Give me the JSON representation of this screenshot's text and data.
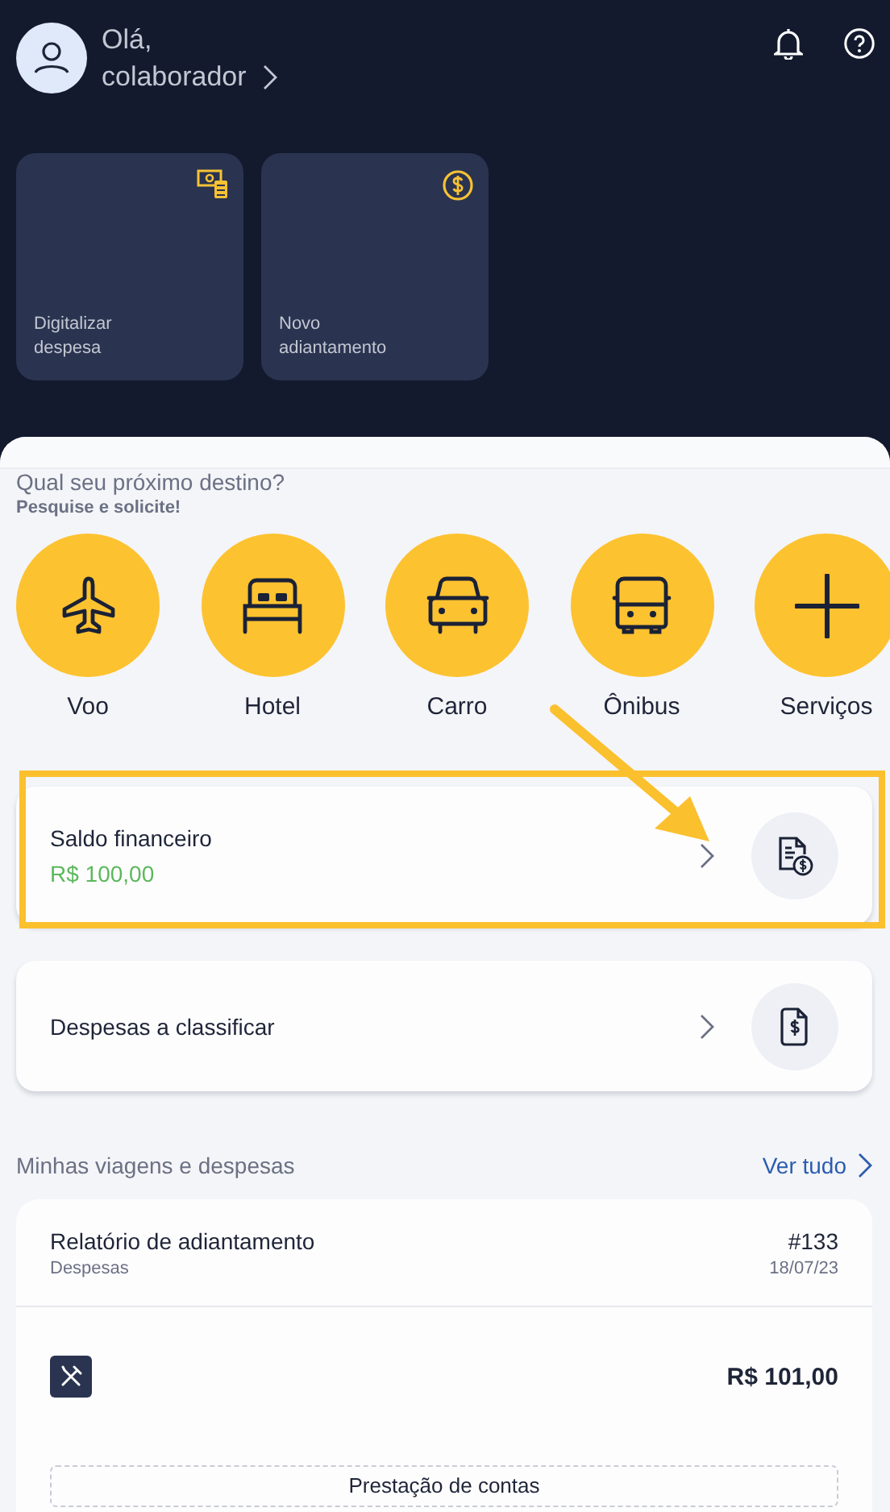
{
  "header": {
    "greeting": "Olá,",
    "user": "colaborador"
  },
  "shortcuts": [
    {
      "label": "Digitalizar despesa"
    },
    {
      "label": "Novo adiantamento"
    }
  ],
  "destinations": {
    "title": "Qual seu próximo destino?",
    "subtitle": "Pesquise e solicite!",
    "items": [
      {
        "label": "Voo"
      },
      {
        "label": "Hotel"
      },
      {
        "label": "Carro"
      },
      {
        "label": "Ônibus"
      },
      {
        "label": "Serviços"
      }
    ]
  },
  "cards": [
    {
      "title": "Saldo financeiro",
      "amount": "R$ 100,00",
      "highlighted": true
    },
    {
      "title": "Despesas a classificar",
      "highlighted": false
    }
  ],
  "trips": {
    "title": "Minhas viagens e despesas",
    "link": "Ver tudo"
  },
  "report": {
    "title": "Relatório de adiantamento",
    "category": "Despesas",
    "number": "#133",
    "date": "18/07/23",
    "amount": "R$ 101,00",
    "action": "Prestação de contas"
  }
}
